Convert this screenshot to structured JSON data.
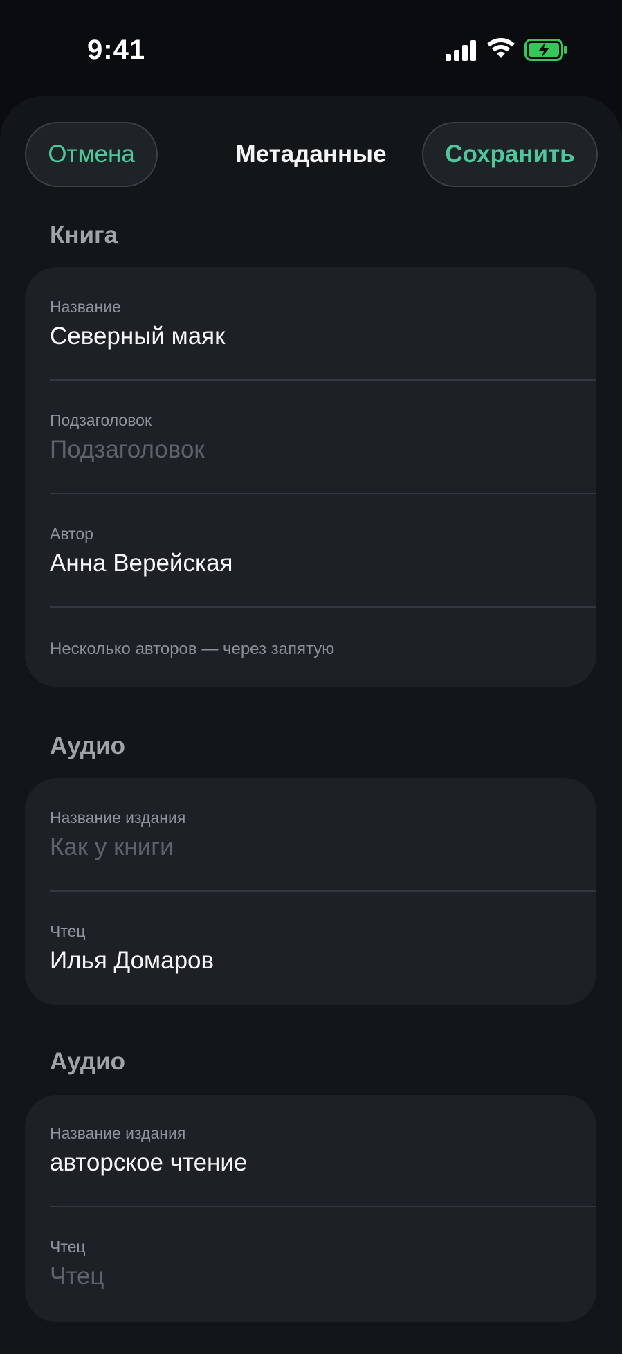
{
  "status_bar": {
    "time": "9:41",
    "icons": [
      "signal-icon",
      "wifi-icon",
      "battery-charging-icon"
    ],
    "battery_color": "#35c759"
  },
  "nav": {
    "cancel_label": "Отмена",
    "title": "Метаданные",
    "save_label": "Сохранить",
    "accent_color": "#4fc79a"
  },
  "book": {
    "section_title": "Книга",
    "title_label": "Название",
    "title_value": "Северный маяк",
    "subtitle_label": "Подзаголовок",
    "subtitle_placeholder": "Подзаголовок",
    "author_label": "Автор",
    "author_value": "Анна Верейская",
    "author_hint": "Несколько авторов — через запятую"
  },
  "audio_1": {
    "section_title": "Аудио",
    "edition_label": "Название издания",
    "edition_placeholder": "Как у книги",
    "narrator_label": "Чтец",
    "narrator_value": "Илья Домаров"
  },
  "audio_2": {
    "section_title": "Аудио",
    "edition_label": "Название издания",
    "edition_value": "авторское чтение",
    "narrator_label": "Чтец",
    "narrator_placeholder": "Чтец"
  }
}
